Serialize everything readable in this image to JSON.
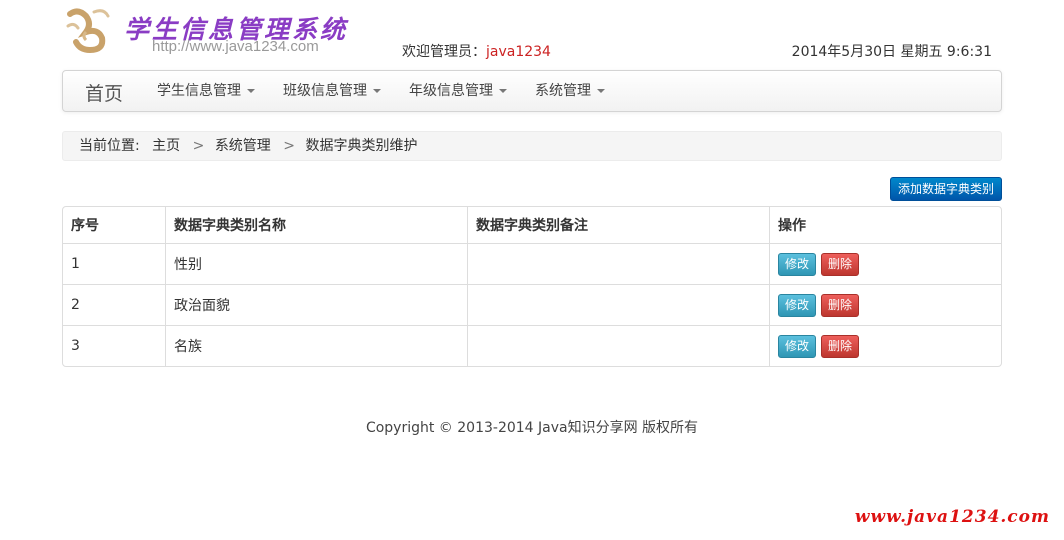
{
  "header": {
    "logo_title": "学生信息管理系统",
    "logo_url": "http://www.java1234.com",
    "welcome_prefix": "欢迎管理员：",
    "welcome_user": "java1234",
    "datetime": "2014年5月30日 星期五 9:6:31"
  },
  "navbar": {
    "brand": "首页",
    "items": [
      {
        "label": "学生信息管理"
      },
      {
        "label": "班级信息管理"
      },
      {
        "label": "年级信息管理"
      },
      {
        "label": "系统管理"
      }
    ]
  },
  "breadcrumb": {
    "prefix": "当前位置:",
    "items": [
      "主页",
      "系统管理",
      "数据字典类别维护"
    ],
    "separator": ">"
  },
  "toolbar": {
    "add_label": "添加数据字典类别"
  },
  "table": {
    "columns": [
      "序号",
      "数据字典类别名称",
      "数据字典类别备注",
      "操作"
    ],
    "rows": [
      {
        "index": "1",
        "name": "性别",
        "note": ""
      },
      {
        "index": "2",
        "name": "政治面貌",
        "note": ""
      },
      {
        "index": "3",
        "name": "名族",
        "note": ""
      }
    ],
    "edit_label": "修改",
    "delete_label": "删除"
  },
  "footer": {
    "copyright": "Copyright © 2013-2014 Java知识分享网 版权所有"
  },
  "watermark": "www.java1234.com",
  "colors": {
    "accent": "#0066bb",
    "edit_button": "#49afcd",
    "delete_button": "#da4f49",
    "logo_title": "#8a3cc4",
    "user_name": "#cc2222"
  }
}
